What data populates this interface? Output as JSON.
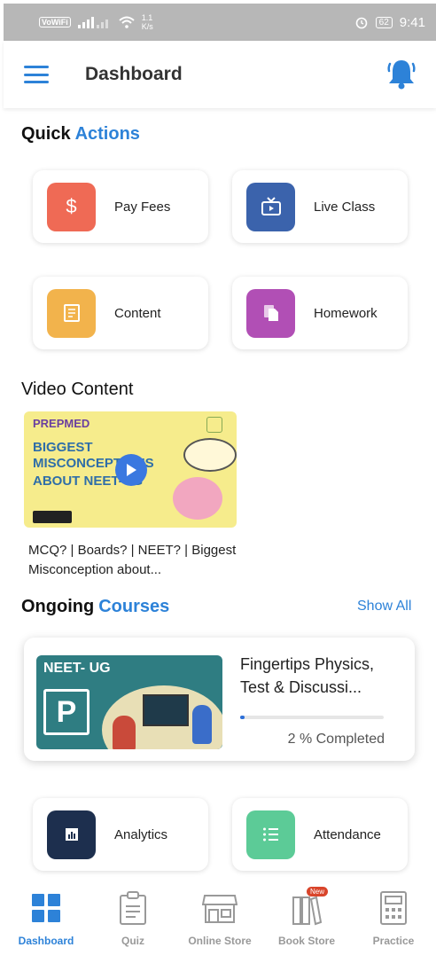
{
  "status_bar": {
    "volte": "VoWiFi",
    "speed_value": "1.1",
    "speed_unit": "K/s",
    "battery": "62",
    "time": "9:41"
  },
  "app_bar": {
    "title": "Dashboard",
    "menu_icon": "hamburger-menu-icon",
    "notification_icon": "bell-icon"
  },
  "quick_actions": {
    "heading_main": "Quick",
    "heading_accent": "Actions",
    "items": [
      {
        "label": "Pay Fees",
        "icon": "dollar-icon",
        "color": "#ef6a55"
      },
      {
        "label": "Live Class",
        "icon": "tv-icon",
        "color": "#3b63ac"
      },
      {
        "label": "Content",
        "icon": "document-icon",
        "color": "#f2b34c"
      },
      {
        "label": "Homework",
        "icon": "files-icon",
        "color": "#b14fb5"
      }
    ]
  },
  "video_content": {
    "heading": "Video Content",
    "thumbnail": {
      "brand": "PREPMED",
      "lines": [
        "BIGGEST",
        "MISCONCEPTIONS",
        "ABOUT NEET-UG"
      ]
    },
    "caption": "MCQ? | Boards? | NEET? | Biggest Misconception about..."
  },
  "ongoing_courses": {
    "heading_main": "Ongoing",
    "heading_accent": "Courses",
    "show_all": "Show All",
    "course": {
      "thumb_title": "NEET- UG",
      "thumb_logo": "P",
      "title": "Fingertips Physics, Test & Discussi...",
      "progress_percent": 2,
      "progress_text": "2 % Completed"
    }
  },
  "more_actions": {
    "items": [
      {
        "label": "Analytics",
        "icon": "chart-icon",
        "color": "#1d2f4e"
      },
      {
        "label": "Attendance",
        "icon": "list-icon",
        "color": "#5ccb97"
      }
    ]
  },
  "bottom_nav": {
    "items": [
      {
        "label": "Dashboard",
        "icon": "grid-icon",
        "active": true
      },
      {
        "label": "Quiz",
        "icon": "clipboard-icon"
      },
      {
        "label": "Online Store",
        "icon": "store-icon"
      },
      {
        "label": "Book Store",
        "icon": "books-icon",
        "badge": "New"
      },
      {
        "label": "Practice",
        "icon": "calculator-icon"
      }
    ]
  },
  "colors": {
    "accent": "#2d82d8",
    "status_bar": "#b7b7b7"
  }
}
